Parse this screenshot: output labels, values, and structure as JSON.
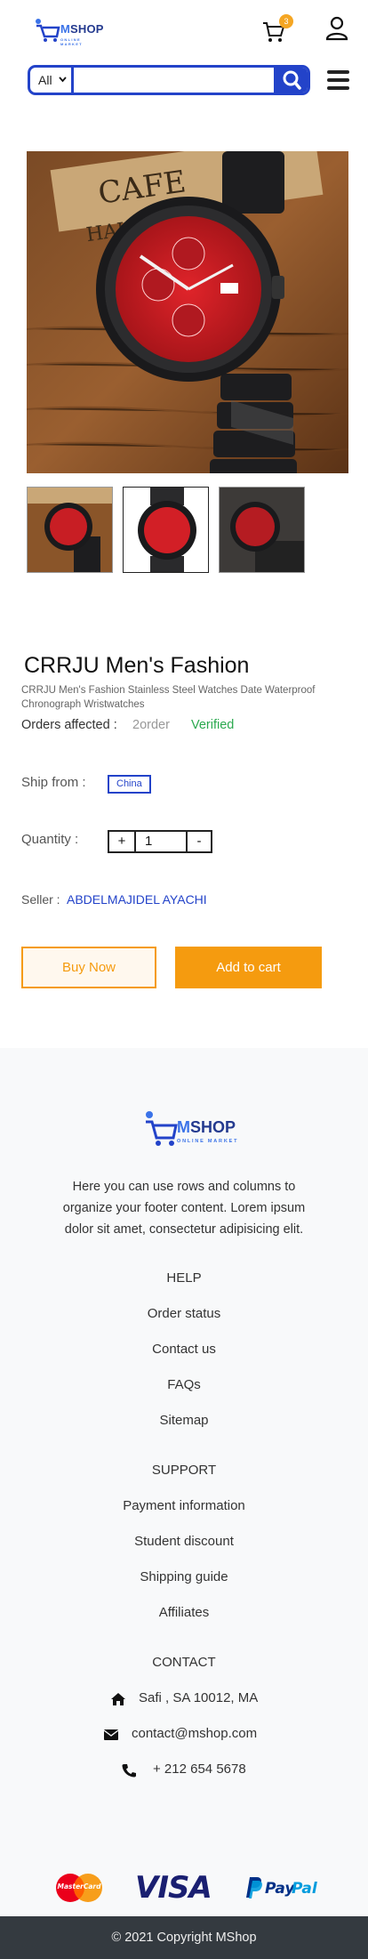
{
  "header": {
    "logo_word_a": "M",
    "logo_word_b": "SHOP",
    "logo_sub": "ONLINE MARKET",
    "cart_count": "3"
  },
  "search": {
    "category": "All",
    "value": ""
  },
  "product": {
    "title": "CRRJU Men's Fashion",
    "description": "CRRJU Men's Fashion Stainless Steel Watches Date Waterproof Chronograph Wristwatches",
    "orders_label": "Orders affected :",
    "orders_value": "2order",
    "verified": "Verified",
    "ship_label": "Ship from :",
    "ship_value": "China",
    "quantity_label": "Quantity :",
    "quantity_plus": "+",
    "quantity_value": "1",
    "quantity_minus": "-",
    "seller_label": "Seller :",
    "seller_value": "ABDELMAJIDEL AYACHI",
    "buy_now": "Buy Now",
    "add_to_cart": "Add to cart"
  },
  "footer": {
    "logo_word_a": "M",
    "logo_word_b": "SHOP",
    "logo_sub": "ONLINE MARKET",
    "text": "Here you can use rows and columns to organize your footer content. Lorem ipsum dolor sit amet, consectetur adipisicing elit.",
    "help_title": "HELP",
    "help_links": [
      "Order status",
      "Contact us",
      "FAQs",
      "Sitemap"
    ],
    "support_title": "SUPPORT",
    "support_links": [
      "Payment information",
      "Student discount",
      "Shipping guide",
      "Affiliates"
    ],
    "contact_title": "CONTACT",
    "address": "Safi , SA 10012, MA",
    "email": "contact@mshop.com",
    "phone": "+ 212 654 5678",
    "mastercard": "MasterCard",
    "visa": "VISA",
    "paypal_a": "Pay",
    "paypal_b": "Pal",
    "copyright": "© 2021 Copyright MShop"
  },
  "colors": {
    "brand_blue": "#2343c9",
    "accent_orange": "#f59b0f",
    "verified_green": "#2ba94f"
  }
}
